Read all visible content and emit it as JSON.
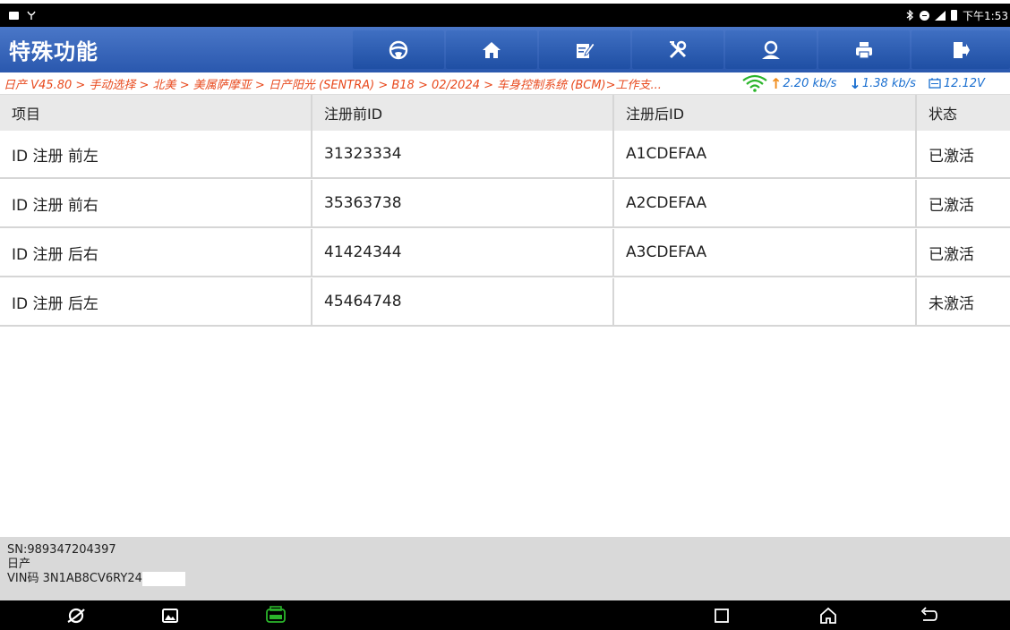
{
  "statusbar": {
    "time": "下午1:53"
  },
  "titlebar": {
    "title": "特殊功能",
    "buttons": [
      {
        "icon": "steering-wheel-icon"
      },
      {
        "icon": "home-icon"
      },
      {
        "icon": "edit-report-icon"
      },
      {
        "icon": "tools-icon"
      },
      {
        "icon": "user-icon"
      },
      {
        "icon": "print-icon"
      },
      {
        "icon": "exit-icon"
      }
    ]
  },
  "breadcrumb": {
    "path": "日产 V45.80 > 手动选择 > 北美 > 美属萨摩亚 > 日产阳光 (SENTRA) > B18 > 02/2024 > 车身控制系统 (BCM)>工作支...",
    "upload": "2.20 kb/s",
    "download": "1.38 kb/s",
    "voltage": "12.12V"
  },
  "table": {
    "headers": [
      "项目",
      "注册前ID",
      "注册后ID",
      "状态"
    ],
    "rows": [
      {
        "item": "ID 注册 前左",
        "before": "31323334",
        "after": "A1CDEFAA",
        "status": "已激活"
      },
      {
        "item": "ID 注册 前右",
        "before": "35363738",
        "after": "A2CDEFAA",
        "status": "已激活"
      },
      {
        "item": "ID 注册 后右",
        "before": "41424344",
        "after": "A3CDEFAA",
        "status": "已激活"
      },
      {
        "item": "ID 注册 后左",
        "before": "45464748",
        "after": "",
        "status": "未激活"
      }
    ]
  },
  "footer": {
    "sn": "SN:989347204397",
    "brand": "日产",
    "vin": "VIN码 3N1AB8CV6RY24"
  },
  "navbar": {
    "items": [
      "browser-icon",
      "gallery-icon",
      "vci-icon",
      "recent-apps-icon",
      "home-nav-icon",
      "back-icon"
    ]
  },
  "colors": {
    "title_blue": "#2a58ae",
    "breadcrumb_orange": "#e8491d",
    "net_blue": "#1a6fd0",
    "vci_green": "#2bb52b"
  }
}
